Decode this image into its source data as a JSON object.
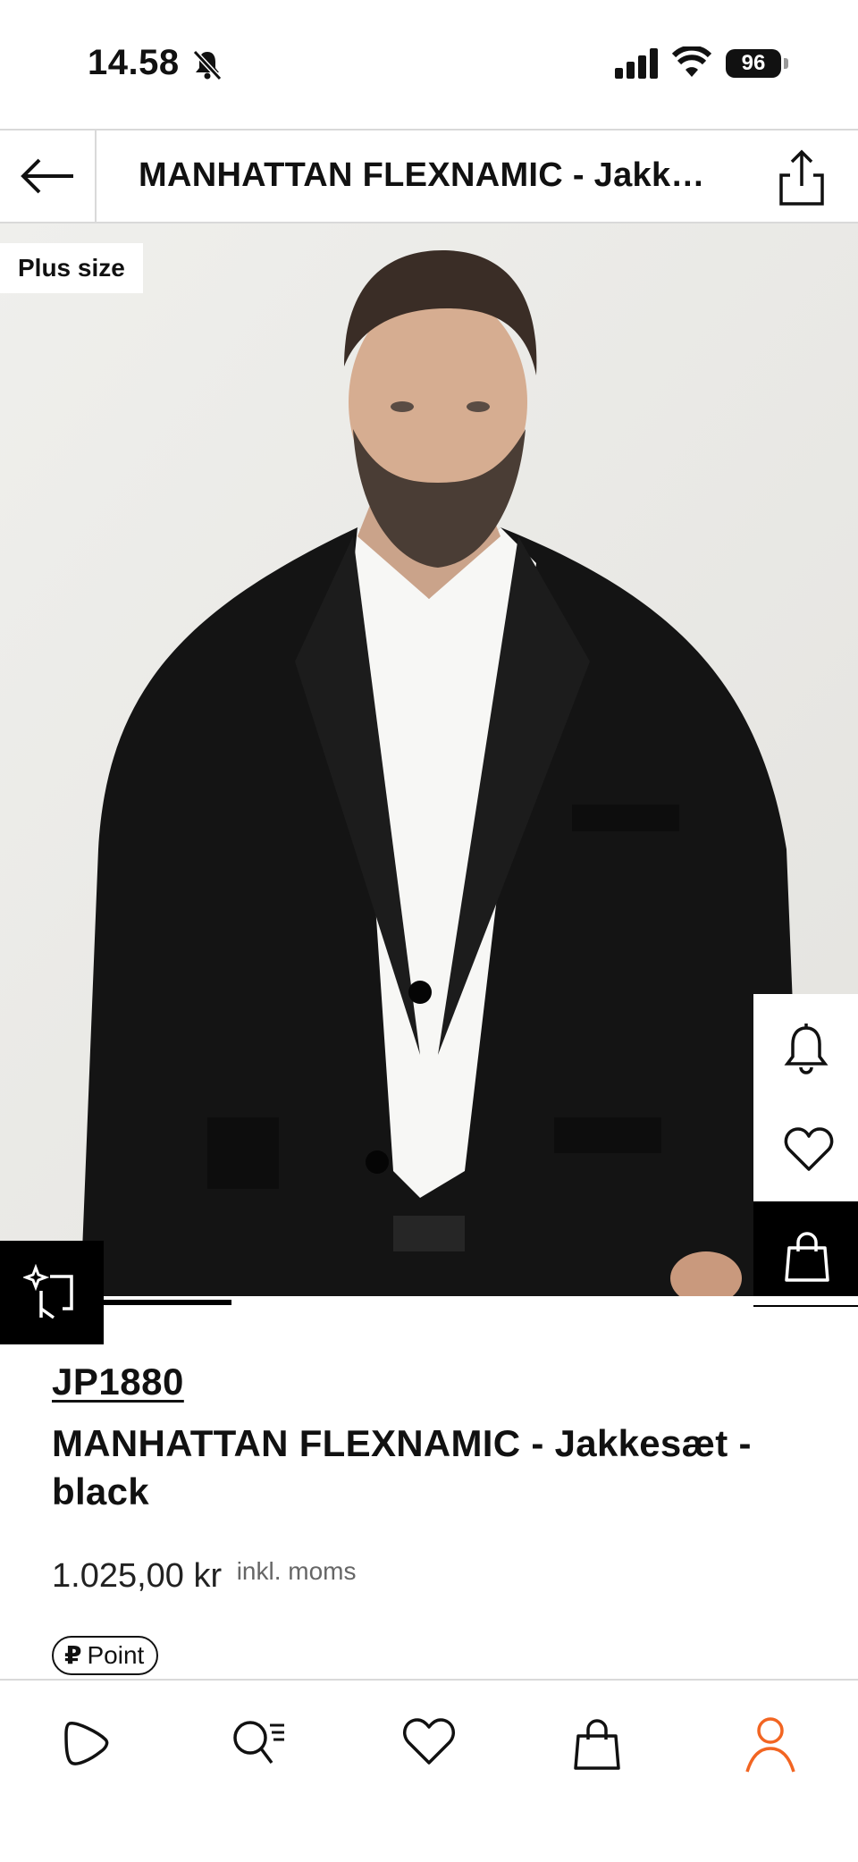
{
  "status_bar": {
    "time": "14.58",
    "battery": "96",
    "icons": [
      "bell-slash-icon",
      "signal-icon",
      "wifi-icon",
      "battery-icon"
    ]
  },
  "header": {
    "title": "MANHATTAN FLEXNAMIC - Jakkesæt - black",
    "icons": [
      "arrow-left-icon",
      "share-icon"
    ]
  },
  "product": {
    "badge": "Plus size",
    "brand": "JP1880",
    "name": "MANHATTAN FLEXNAMIC - Jakkesæt - black",
    "price": "1.025,00 kr",
    "vat_note": "inkl. moms",
    "points_label": "Point",
    "points_glyph": "₽",
    "gallery_position": 0.17,
    "image_description_icon": "product-photo"
  },
  "side_actions": {
    "icons": [
      "bell-icon",
      "heart-icon",
      "shopping-bag-icon"
    ]
  },
  "tab_bar": {
    "active_color": "#f26522",
    "icons": [
      "play-icon",
      "search-icon",
      "heart-icon",
      "shopping-bag-icon",
      "user-icon"
    ],
    "active_tab": "user-icon"
  }
}
